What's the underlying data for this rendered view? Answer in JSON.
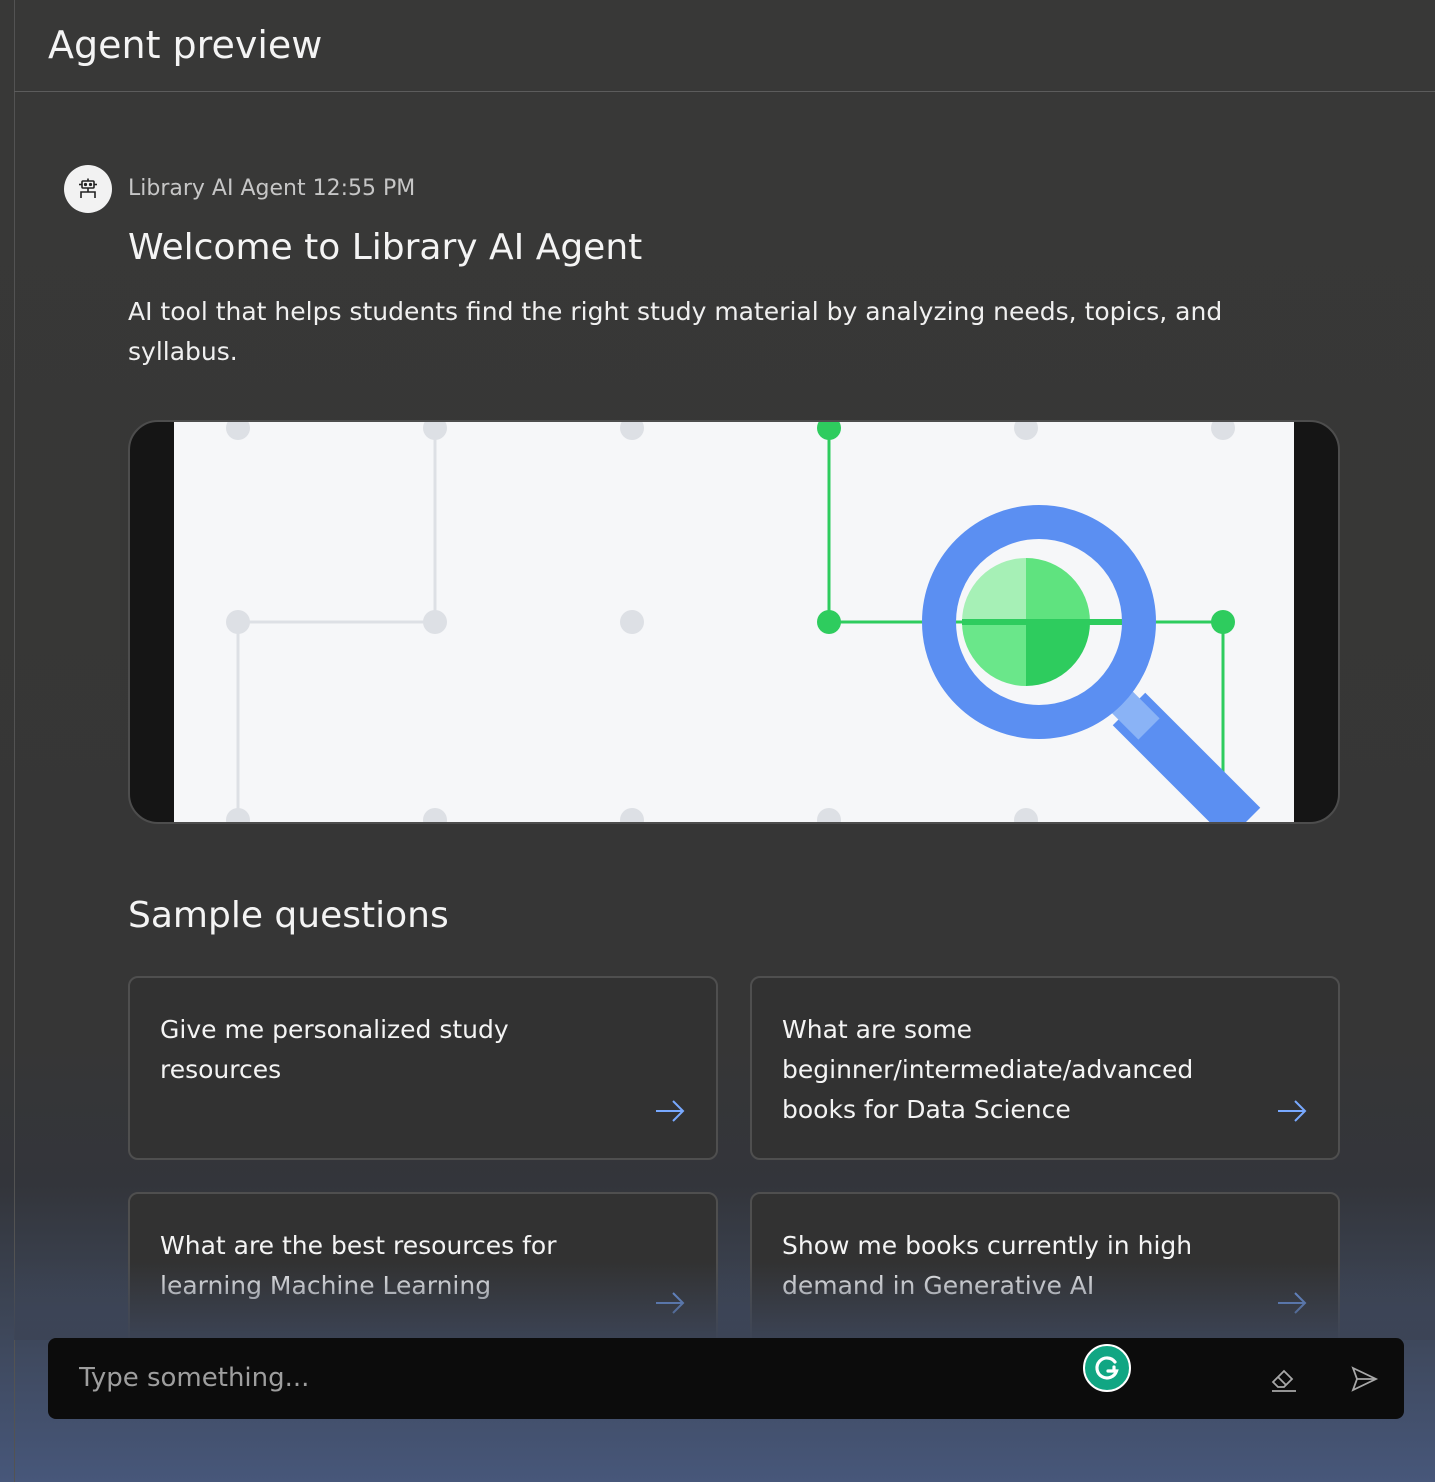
{
  "header": {
    "title": "Agent preview"
  },
  "message": {
    "sender": "Library AI Agent",
    "time": "12:55 PM",
    "avatar_icon": "robot-icon",
    "welcome_title": "Welcome to Library AI Agent",
    "description": "AI tool that helps students find the right study material by analyzing needs, topics, and syllabus.",
    "hero_illustration_icon": "magnifying-glass-icon"
  },
  "sample_questions": {
    "title": "Sample questions",
    "items": [
      {
        "text": "Give me personalized study resources",
        "icon": "arrow-right-icon"
      },
      {
        "text": "What are some beginner/intermediate/advanced books for Data Science",
        "icon": "arrow-right-icon"
      },
      {
        "text": "What are the best resources for learning Machine Learning",
        "icon": "arrow-right-icon"
      },
      {
        "text": "Show me books currently in high demand in Generative AI",
        "icon": "arrow-right-icon"
      }
    ]
  },
  "input": {
    "placeholder": "Type something...",
    "value": "",
    "grammarly_icon": "grammarly-icon",
    "erase_icon": "eraser-icon",
    "send_icon": "send-icon"
  },
  "colors": {
    "background": "#363636",
    "bottom_gradient": "#47577a",
    "input_bar": "#0c0c0c",
    "accent_blue": "#5b8ff2",
    "accent_green": "#2ecc5e",
    "arrow_blue": "#78a9ff",
    "grammarly_green": "#11a683"
  }
}
